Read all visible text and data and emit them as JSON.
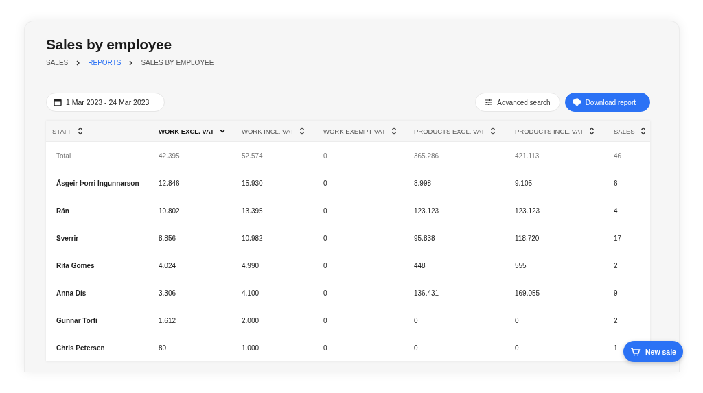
{
  "title": "Sales by employee",
  "breadcrumbs": [
    {
      "label": "SALES",
      "link": false
    },
    {
      "label": "REPORTS",
      "link": true
    },
    {
      "label": "SALES BY EMPLOYEE",
      "link": false
    }
  ],
  "date_range": "1 Mar 2023 - 24 Mar 2023",
  "buttons": [
    {
      "label": "Advanced search",
      "kind": "secondary"
    },
    {
      "label": "Download report",
      "kind": "primary"
    }
  ],
  "table": {
    "columns": [
      {
        "label": "STAFF",
        "sorted": false
      },
      {
        "label": "WORK EXCL. VAT",
        "sorted": true
      },
      {
        "label": "WORK INCL. VAT",
        "sorted": false
      },
      {
        "label": "WORK EXEMPT VAT",
        "sorted": false
      },
      {
        "label": "PRODUCTS EXCL. VAT",
        "sorted": false
      },
      {
        "label": "PRODUCTS INCL. VAT",
        "sorted": false
      },
      {
        "label": "SALES",
        "sorted": false
      }
    ],
    "rows": [
      {
        "kind": "total",
        "cells": [
          "Total",
          "42.395",
          "52.574",
          "0",
          "365.286",
          "421.113",
          "46"
        ]
      },
      {
        "kind": "staff",
        "cells": [
          "Ásgeir Þorri Ingunnarson",
          "12.846",
          "15.930",
          "0",
          "8.998",
          "9.105",
          "6"
        ]
      },
      {
        "kind": "staff",
        "cells": [
          "Rán",
          "10.802",
          "13.395",
          "0",
          "123.123",
          "123.123",
          "4"
        ]
      },
      {
        "kind": "staff",
        "cells": [
          "Sverrir",
          "8.856",
          "10.982",
          "0",
          "95.838",
          "118.720",
          "17"
        ]
      },
      {
        "kind": "staff",
        "cells": [
          "Rita Gomes",
          "4.024",
          "4.990",
          "0",
          "448",
          "555",
          "2"
        ]
      },
      {
        "kind": "staff",
        "cells": [
          "Anna Dís",
          "3.306",
          "4.100",
          "0",
          "136.431",
          "169.055",
          "9"
        ]
      },
      {
        "kind": "staff",
        "cells": [
          "Gunnar Torfi",
          "1.612",
          "2.000",
          "0",
          "0",
          "0",
          "2"
        ]
      },
      {
        "kind": "staff",
        "cells": [
          "Chris Petersen",
          "80",
          "1.000",
          "0",
          "0",
          "0",
          "1"
        ]
      }
    ]
  },
  "fab": {
    "label": "New sale"
  }
}
